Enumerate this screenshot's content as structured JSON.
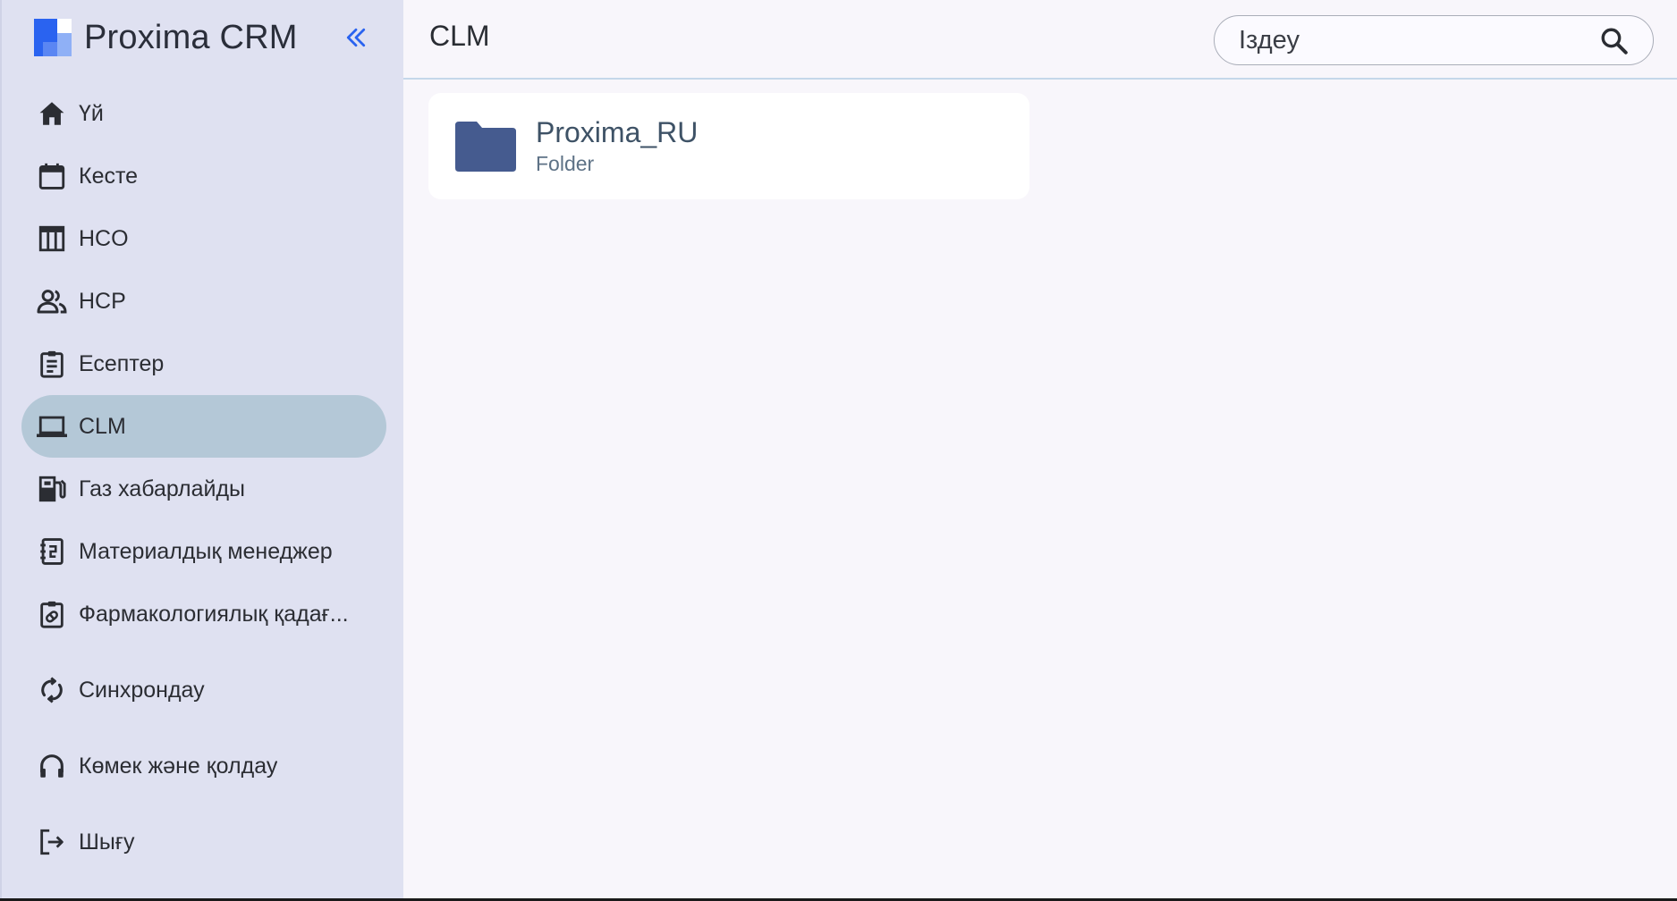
{
  "brand": {
    "name": "Proxima CRM"
  },
  "sidebar": {
    "items": [
      {
        "label": "Үй",
        "icon": "home-icon",
        "active": false
      },
      {
        "label": "Кесте",
        "icon": "calendar-icon",
        "active": false
      },
      {
        "label": "HCO",
        "icon": "table-icon",
        "active": false
      },
      {
        "label": "HCP",
        "icon": "people-icon",
        "active": false
      },
      {
        "label": "Есептер",
        "icon": "clipboard-icon",
        "active": false
      },
      {
        "label": "CLM",
        "icon": "laptop-icon",
        "active": true
      },
      {
        "label": "Газ хабарлайды",
        "icon": "fuel-icon",
        "active": false
      },
      {
        "label": "Материалдық менеджер",
        "icon": "notebook-icon",
        "active": false
      },
      {
        "label": "Фармакологиялық қадағ...",
        "icon": "medical-clipboard-icon",
        "active": false
      },
      {
        "label": "Синхрондау",
        "icon": "sync-icon",
        "active": false
      },
      {
        "label": "Көмек және қолдау",
        "icon": "headset-icon",
        "active": false
      },
      {
        "label": "Шығу",
        "icon": "logout-icon",
        "active": false
      }
    ]
  },
  "header": {
    "title": "CLM",
    "search": {
      "placeholder": "Іздеу",
      "value": ""
    }
  },
  "main": {
    "items": [
      {
        "title": "Proxima_RU",
        "subtitle": "Folder",
        "icon": "folder-icon"
      }
    ]
  },
  "colors": {
    "accent": "#2a63f0",
    "sidebar_bg": "#dfe1f1",
    "active_item_bg": "#b4c8d7",
    "folder": "#455b8f"
  }
}
